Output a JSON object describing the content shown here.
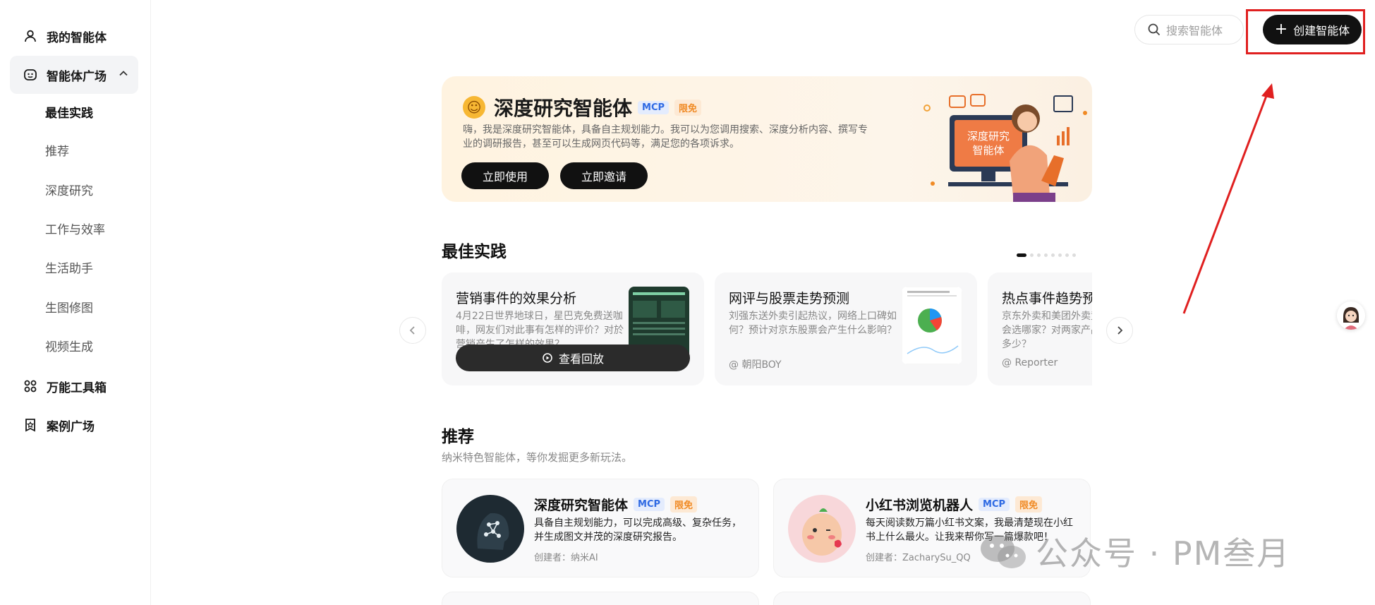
{
  "sidebar": {
    "my_agents": "我的智能体",
    "agent_square": "智能体广场",
    "sub_items": [
      "最佳实践",
      "推荐",
      "深度研究",
      "工作与效率",
      "生活助手",
      "生图修图",
      "视频生成"
    ],
    "toolbox": "万能工具箱",
    "case_square": "案例广场"
  },
  "header": {
    "search_placeholder": "搜索智能体",
    "create_button": "创建智能体"
  },
  "banner": {
    "title": "深度研究智能体",
    "tag_mcp": "MCP",
    "tag_free": "限免",
    "desc": "嗨，我是深度研究智能体，具备自主规划能力。我可以为您调用搜索、深度分析内容、撰写专业的调研报告，甚至可以生成网页代码等，满足您的各项诉求。",
    "btn_use": "立即使用",
    "btn_invite": "立即邀请",
    "illustration_label": "深度研究\n智能体"
  },
  "best_practice": {
    "title": "最佳实践",
    "cards": [
      {
        "title": "营销事件的效果分析",
        "desc": "4月22日世界地球日，星巴克免费送咖啡，网友们对此事有怎样的评价？对於营销产生了怎样的效果？",
        "button": "查看回放"
      },
      {
        "title": "网评与股票走势预测",
        "desc": "刘强东送外卖引起热议，网络上口碑如何？预计对京东股票会产生什么影响？",
        "author": "@ 朝阳BOY"
      },
      {
        "title": "热点事件趋势预测",
        "desc": "京东外卖和美团外卖竞争的话，网友们会选哪家？对两家产品的支持率分别是多少？",
        "author": "@ Reporter"
      }
    ]
  },
  "recommend": {
    "title": "推荐",
    "subtitle": "纳米特色智能体，等你发掘更多新玩法。",
    "cards": [
      {
        "name": "深度研究智能体",
        "tag_mcp": "MCP",
        "tag_free": "限免",
        "desc": "具备自主规划能力，可以完成高级、复杂任务，并生成图文并茂的深度研究报告。",
        "author": "创建者：纳米AI"
      },
      {
        "name": "小红书浏览机器人",
        "tag_mcp": "MCP",
        "tag_free": "限免",
        "desc": "每天阅读数万篇小红书文案，我最清楚现在小红书上什么最火。让我来帮你写一篇爆款吧！",
        "author": "创建者：ZacharySu_QQ"
      }
    ]
  },
  "watermark": "公众号 · PM叁月",
  "colors": {
    "accent": "#111111",
    "mcp": "#2f6ae3",
    "free": "#f08a24",
    "highlight": "#e02020"
  }
}
